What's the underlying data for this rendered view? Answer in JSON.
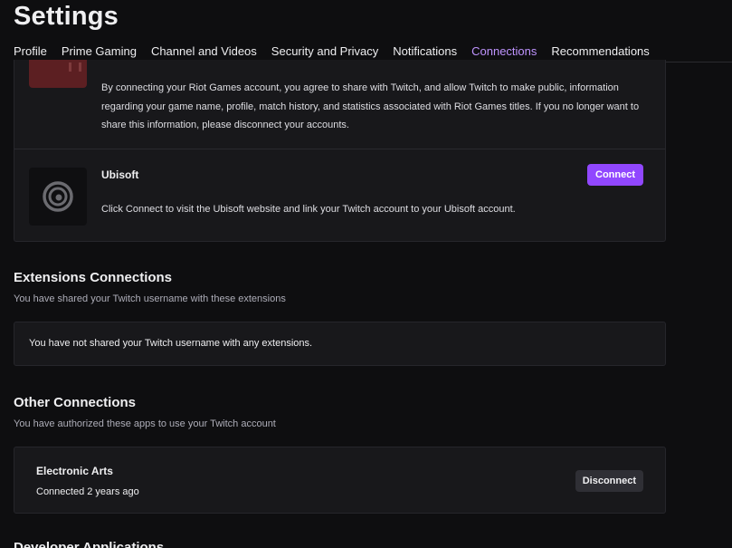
{
  "page": {
    "title": "Settings"
  },
  "tabs": [
    {
      "label": "Profile"
    },
    {
      "label": "Prime Gaming"
    },
    {
      "label": "Channel and Videos"
    },
    {
      "label": "Security and Privacy"
    },
    {
      "label": "Notifications"
    },
    {
      "label": "Connections",
      "active": true
    },
    {
      "label": "Recommendations"
    }
  ],
  "connections": {
    "riot": {
      "description": "By connecting your Riot Games account, you agree to share with Twitch, and allow Twitch to make public, information regarding your game name, profile, match history, and statistics associated with Riot Games titles. If you no longer want to share this information, please disconnect your accounts.",
      "logo_color": "#5c1f22"
    },
    "ubisoft": {
      "name": "Ubisoft",
      "description": "Click Connect to visit the Ubisoft website and link your Twitch account to your Ubisoft account.",
      "button_label": "Connect",
      "logo_icon": "ubisoft-swirl-icon"
    }
  },
  "extensions": {
    "title": "Extensions Connections",
    "subtitle": "You have shared your Twitch username with these extensions",
    "empty_message": "You have not shared your Twitch username with any extensions."
  },
  "other": {
    "title": "Other Connections",
    "subtitle": "You have authorized these apps to use your Twitch account",
    "apps": [
      {
        "name": "Electronic Arts",
        "status": "Connected 2 years ago",
        "button_label": "Disconnect"
      }
    ]
  },
  "next_section": {
    "title": "Developer Applications"
  },
  "colors": {
    "accent": "#9147ff",
    "active_tab": "#bf94ff",
    "background": "#0e0e10",
    "card": "#18181b"
  }
}
